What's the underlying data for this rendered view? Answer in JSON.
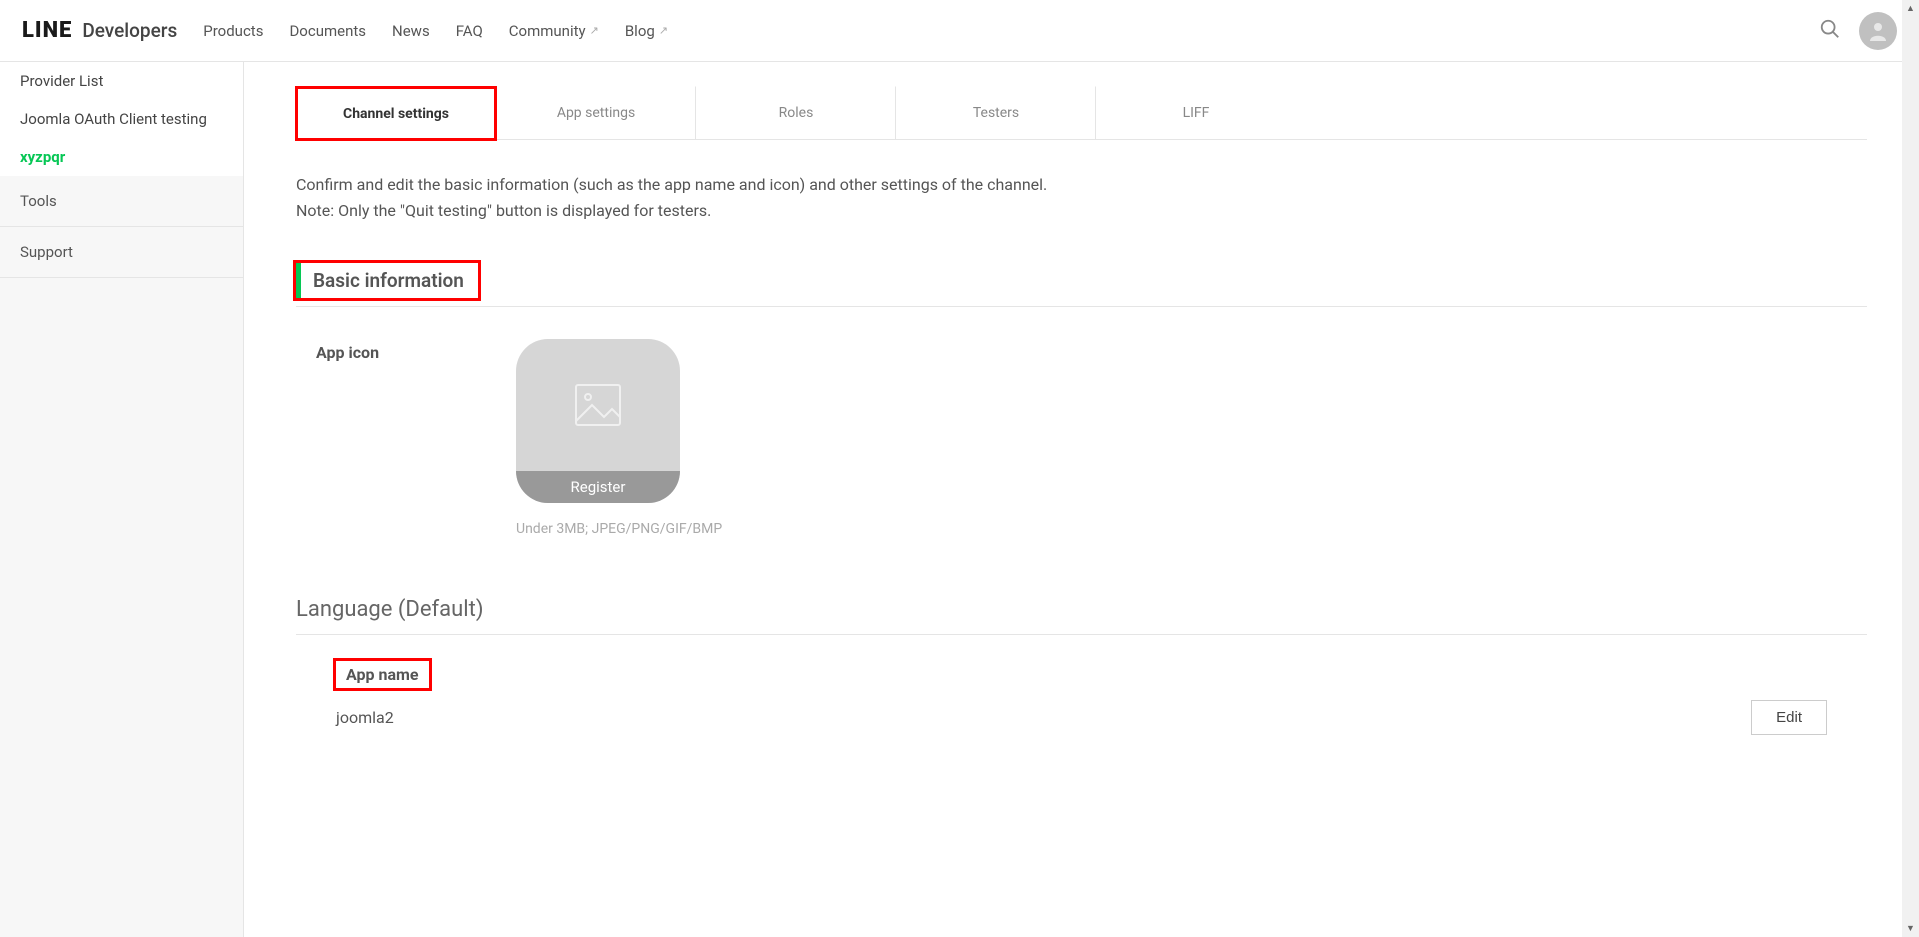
{
  "header": {
    "logo_main": "LINE",
    "logo_sub": "Developers",
    "nav": {
      "products": "Products",
      "documents": "Documents",
      "news": "News",
      "faq": "FAQ",
      "community": "Community",
      "blog": "Blog"
    }
  },
  "sidebar": {
    "provider_list": "Provider List",
    "joomla_testing": "Joomla OAuth Client testing",
    "active_provider": "xyzpqr",
    "tools": "Tools",
    "support": "Support"
  },
  "tabs": {
    "channel_settings": "Channel settings",
    "app_settings": "App settings",
    "roles": "Roles",
    "testers": "Testers",
    "liff": "LIFF"
  },
  "main": {
    "desc_line1": "Confirm and edit the basic information (such as the app name and icon) and other settings of the channel.",
    "desc_line2": "Note: Only the \"Quit testing\" button is displayed for testers.",
    "basic_info_title": "Basic information",
    "app_icon_label": "App icon",
    "register_label": "Register",
    "icon_hint": "Under 3MB; JPEG/PNG/GIF/BMP",
    "language_title": "Language (Default)",
    "app_name_label": "App name",
    "app_name_value": "joomla2",
    "edit_label": "Edit"
  }
}
